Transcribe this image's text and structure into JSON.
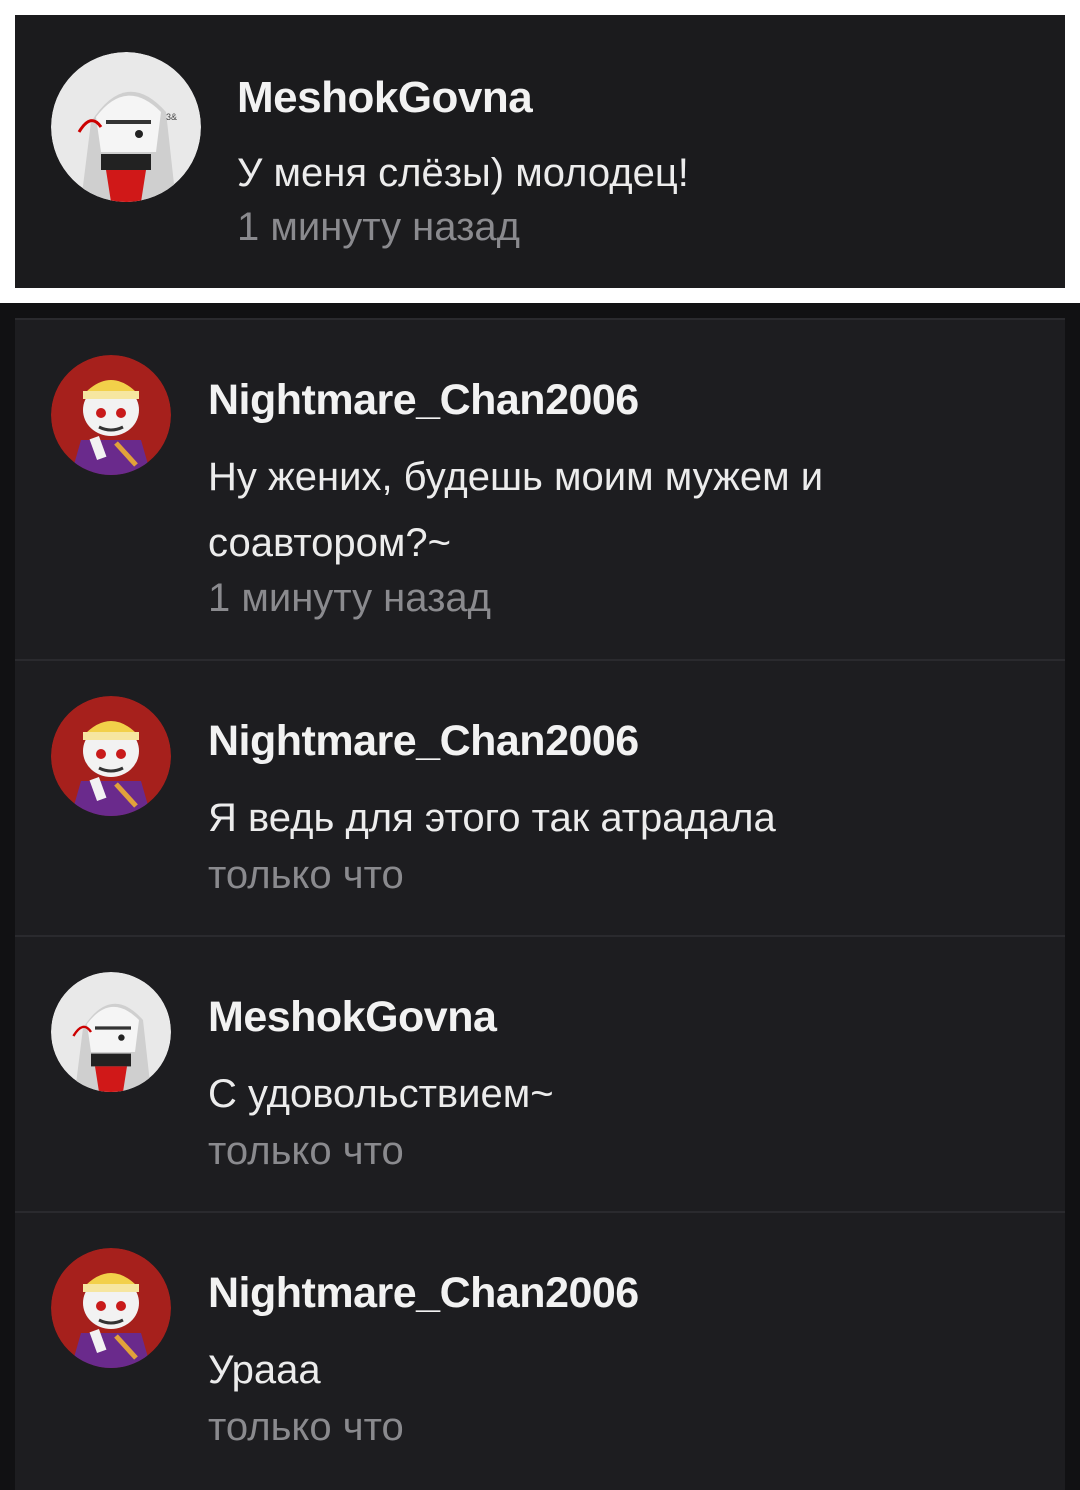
{
  "comments": [
    {
      "username": "MeshokGovna",
      "text": "У меня слёзы) молодец!",
      "time": "1 минуту назад",
      "avatar_icon": "meshok-avatar-icon"
    },
    {
      "username": "Nightmare_Chan2006",
      "text": "Ну жених, будешь моим мужем и соавтором?~",
      "time": "1 минуту назад",
      "avatar_icon": "nightmare-avatar-icon"
    },
    {
      "username": "Nightmare_Chan2006",
      "text": "Я ведь для этого так атрадала",
      "time": "только что",
      "avatar_icon": "nightmare-avatar-icon"
    },
    {
      "username": "MeshokGovna",
      "text": "С удовольствием~",
      "time": "только что",
      "avatar_icon": "meshok-avatar-icon"
    },
    {
      "username": "Nightmare_Chan2006",
      "text": "Урааа",
      "time": "только что",
      "avatar_icon": "nightmare-avatar-icon"
    }
  ],
  "colors": {
    "card_background": "#1b1b1d",
    "thread_background": "#1d1d20",
    "username": "#f2f2f2",
    "message": "#ececec",
    "time": "#8a8a8e"
  }
}
